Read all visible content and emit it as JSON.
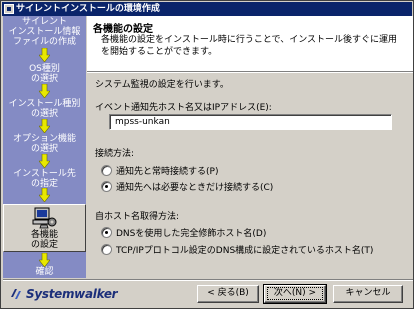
{
  "window": {
    "title": "サイレントインストールの環境作成"
  },
  "steps": [
    {
      "label": "サイレント\nインストール情報\nファイルの作成",
      "active": false
    },
    {
      "label": "OS種別\nの選択",
      "active": false
    },
    {
      "label": "インストール種別\nの選択",
      "active": false
    },
    {
      "label": "オプション機能\nの選択",
      "active": false
    },
    {
      "label": "インストール先\nの指定",
      "active": false
    },
    {
      "label": "各機能\nの設定",
      "active": true
    },
    {
      "label": "確認",
      "active": false
    }
  ],
  "header": {
    "title": "各機能の設定",
    "description": "各機能の設定をインストール時に行うことで、インストール後すぐに運用を開始することができます。"
  },
  "panel": {
    "subtitle": "システム監視の設定を行います。",
    "event_host_label": "イベント通知先ホスト名又はIPアドレス(E):",
    "event_host_value": "mpss-unkan",
    "connect_method_label": "接続方法:",
    "connect_options": [
      {
        "label": "通知先と常時接続する(P)",
        "checked": false
      },
      {
        "label": "通知先へは必要なときだけ接続する(C)",
        "checked": true
      }
    ],
    "hostname_method_label": "自ホスト名取得方法:",
    "hostname_options": [
      {
        "label": "DNSを使用した完全修飾ホスト名(D)",
        "checked": true
      },
      {
        "label": "TCP/IPプロトコル設定のDNS構成に設定されているホスト名(T)",
        "checked": false
      }
    ]
  },
  "footer": {
    "logo_text": "Systemwalker",
    "back_label": "< 戻る(B)",
    "next_label": "次へ(N) >",
    "cancel_label": "キャンセル"
  },
  "colors": {
    "titlebar": "#0a246a",
    "steps_bg": "#848bc4",
    "arrow": "#e8e800",
    "logo": "#1c2f7a"
  }
}
